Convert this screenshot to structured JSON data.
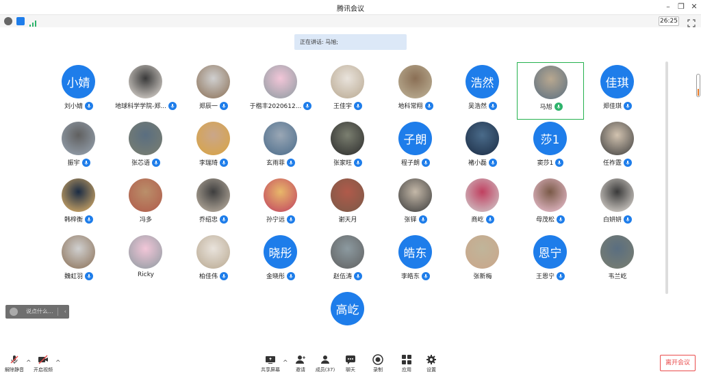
{
  "window": {
    "title": "腾讯会议"
  },
  "infobar": {
    "timer": "26:25"
  },
  "speaking": {
    "text": "正在讲话: 马旭;"
  },
  "colors": {
    "accent": "#1e7dea",
    "speaking_bg": "#dce8f7",
    "highlight": "#22b14c",
    "leave": "#e94a4a"
  },
  "participants": [
    {
      "name": "刘小婧",
      "avatar_text": "小婧",
      "mic": "blue"
    },
    {
      "name": "地球科学学院-郑...",
      "avatar_text": "",
      "mic": "blue"
    },
    {
      "name": "郑辰一",
      "avatar_text": "",
      "mic": "blue"
    },
    {
      "name": "于楷丰2020612...",
      "avatar_text": "",
      "mic": "blue"
    },
    {
      "name": "王佳宇",
      "avatar_text": "",
      "mic": "blue"
    },
    {
      "name": "地科常翔",
      "avatar_text": "",
      "mic": "blue"
    },
    {
      "name": "吴浩然",
      "avatar_text": "浩然",
      "mic": "blue"
    },
    {
      "name": "马旭",
      "avatar_text": "",
      "mic": "green",
      "speaking": true
    },
    {
      "name": "郑佳琪",
      "avatar_text": "佳琪",
      "mic": "blue"
    },
    {
      "name": "振宇",
      "avatar_text": "",
      "mic": "blue"
    },
    {
      "name": "张芯语",
      "avatar_text": "",
      "mic": "blue"
    },
    {
      "name": "李瑞琦",
      "avatar_text": "",
      "mic": "blue"
    },
    {
      "name": "玄雨菲",
      "avatar_text": "",
      "mic": "blue"
    },
    {
      "name": "张家旺",
      "avatar_text": "",
      "mic": "blue"
    },
    {
      "name": "程子朗",
      "avatar_text": "子朗",
      "mic": "blue"
    },
    {
      "name": "褚小磊",
      "avatar_text": "",
      "mic": "blue"
    },
    {
      "name": "窦莎1",
      "avatar_text": "莎1",
      "mic": "blue"
    },
    {
      "name": "任祚霆",
      "avatar_text": "",
      "mic": "blue"
    },
    {
      "name": "韩梓衡",
      "avatar_text": "",
      "mic": "blue"
    },
    {
      "name": "冯多",
      "avatar_text": "",
      "mic": "none"
    },
    {
      "name": "乔绍忠",
      "avatar_text": "",
      "mic": "blue"
    },
    {
      "name": "孙宁远",
      "avatar_text": "",
      "mic": "blue"
    },
    {
      "name": "谢天月",
      "avatar_text": "",
      "mic": "none"
    },
    {
      "name": "张铎",
      "avatar_text": "",
      "mic": "blue"
    },
    {
      "name": "商屹",
      "avatar_text": "",
      "mic": "blue"
    },
    {
      "name": "母茂松",
      "avatar_text": "",
      "mic": "blue"
    },
    {
      "name": "白妍妍",
      "avatar_text": "",
      "mic": "blue"
    },
    {
      "name": "魏虹羽",
      "avatar_text": "",
      "mic": "blue"
    },
    {
      "name": "Ricky",
      "avatar_text": "",
      "mic": "none"
    },
    {
      "name": "柏佳伟",
      "avatar_text": "",
      "mic": "blue"
    },
    {
      "name": "金晓彤",
      "avatar_text": "晓彤",
      "mic": "blue"
    },
    {
      "name": "赵伍涛",
      "avatar_text": "",
      "mic": "blue"
    },
    {
      "name": "李皓东",
      "avatar_text": "皓东",
      "mic": "blue"
    },
    {
      "name": "张新梅",
      "avatar_text": "",
      "mic": "none"
    },
    {
      "name": "王恩宁",
      "avatar_text": "恩宁",
      "mic": "blue"
    },
    {
      "name": "韦兰屹",
      "avatar_text": "",
      "mic": "none"
    },
    {
      "name": "",
      "avatar_text": "高屹",
      "mic": "none"
    }
  ],
  "chat": {
    "placeholder": "说点什么..."
  },
  "toolbar": {
    "unmute": "解除静音",
    "start_video": "开启视频",
    "share_screen": "共享屏幕",
    "invite": "邀请",
    "members": "成员(37)",
    "chat": "聊天",
    "record": "录制",
    "apps": "应用",
    "settings": "设置",
    "leave": "离开会议"
  }
}
